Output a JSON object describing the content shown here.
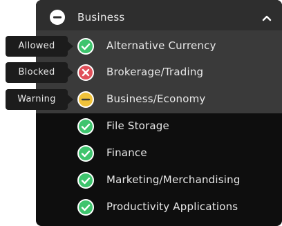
{
  "header": {
    "label": "Business",
    "icon": "minus-circle-icon",
    "chevron": "chevron-up-icon"
  },
  "legend": {
    "allowed": "Allowed",
    "blocked": "Blocked",
    "warning": "Warning"
  },
  "categories": [
    {
      "label": "Alternative Currency",
      "status": "allowed"
    },
    {
      "label": "Brokerage/Trading",
      "status": "blocked"
    },
    {
      "label": "Business/Economy",
      "status": "warning"
    },
    {
      "label": "File Storage",
      "status": "allowed"
    },
    {
      "label": "Finance",
      "status": "allowed"
    },
    {
      "label": "Marketing/Merchandising",
      "status": "allowed"
    },
    {
      "label": "Productivity Applications",
      "status": "allowed"
    }
  ],
  "colors": {
    "allowed": "#3ec46d",
    "blocked": "#e0505a",
    "warning": "#f0c23a"
  }
}
